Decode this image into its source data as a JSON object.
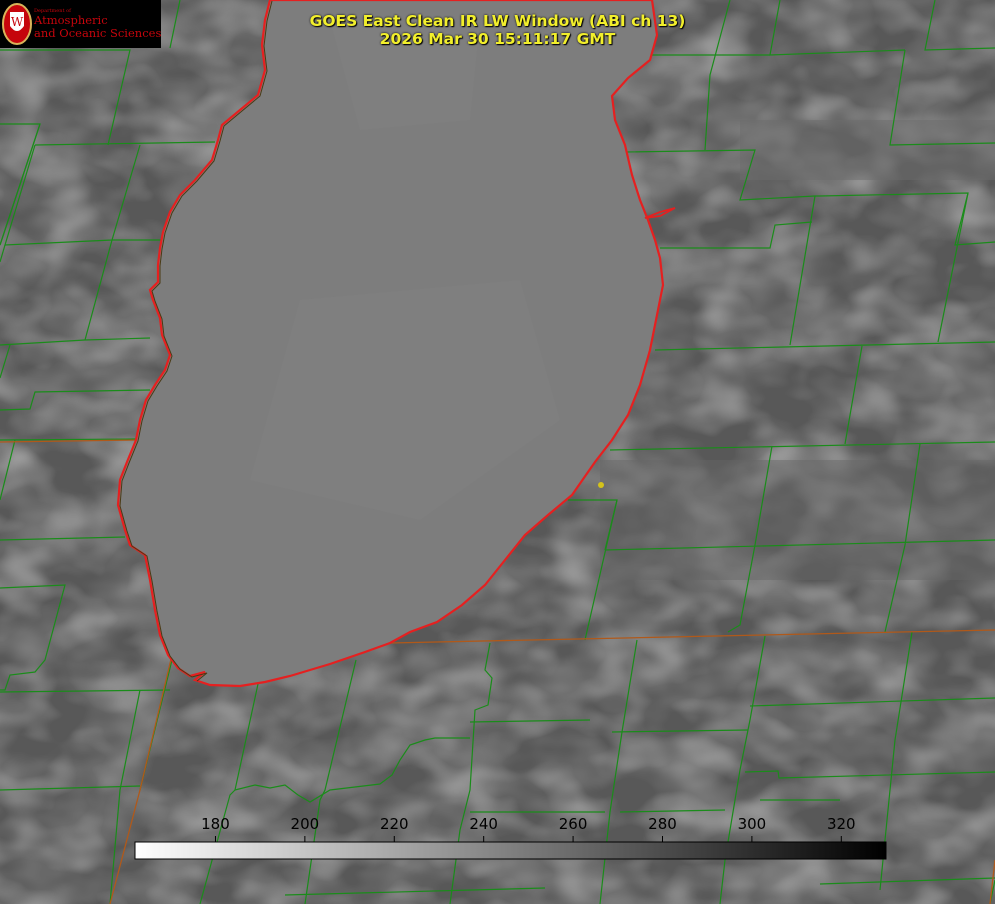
{
  "header": {
    "title_line1": "GOES East Clean IR LW Window (ABI ch 13)",
    "title_line2": "2026 Mar 30 15:11:17 GMT"
  },
  "logo": {
    "dept_text": "Department of",
    "line1": "Atmospheric",
    "line2": "and Oceanic Sciences",
    "seal_letter": "W"
  },
  "colorbar": {
    "ticks": [
      "180",
      "200",
      "220",
      "240",
      "260",
      "280",
      "300",
      "320"
    ],
    "tick_values": [
      180,
      200,
      220,
      240,
      260,
      280,
      300,
      320
    ],
    "range": [
      162,
      330
    ],
    "gradient": "white-to-black"
  },
  "colors": {
    "title": "#f2ef2c",
    "lake_outline": "#ff1a1a",
    "county_lines": "#1a8c1a",
    "state_line": "#b85a1a",
    "land": "#5a5a5a",
    "lake": "#7c7c7c",
    "marker": "#d4c21a"
  }
}
